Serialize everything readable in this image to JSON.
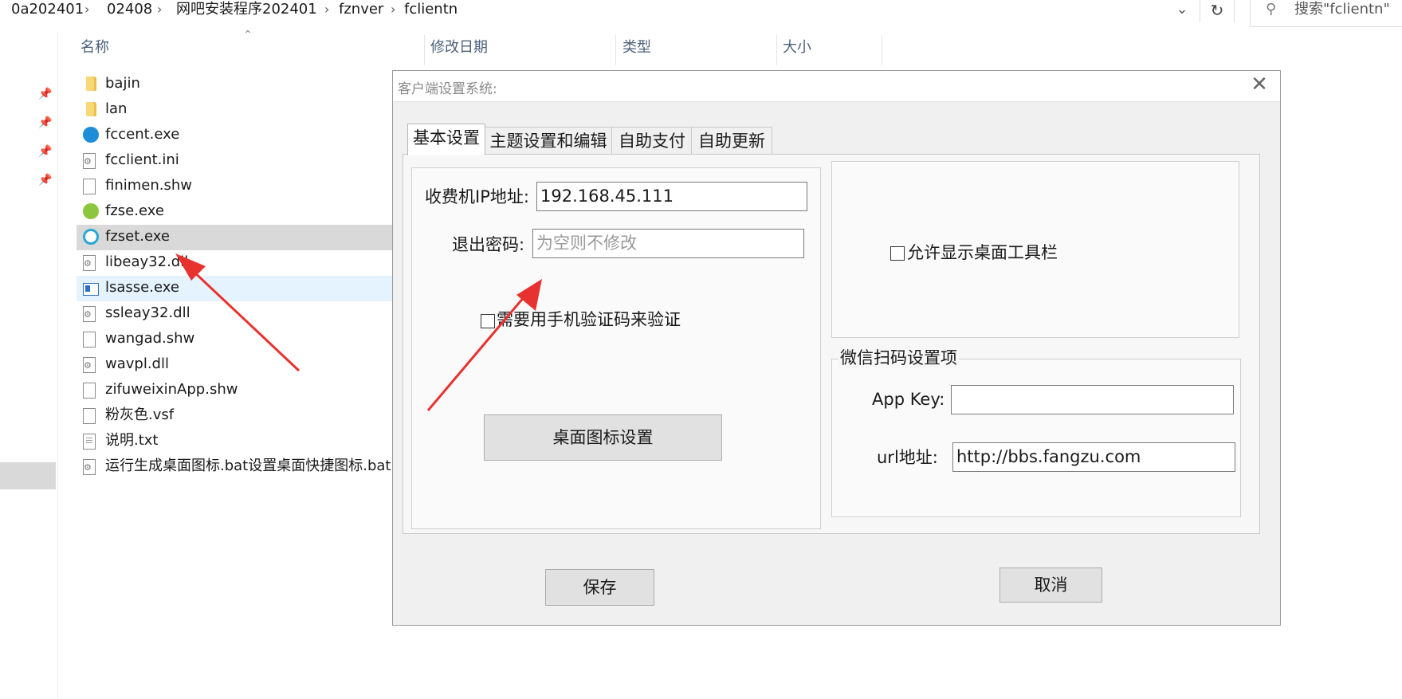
{
  "address_bar": {
    "crumbs": [
      "0a202401",
      "02408",
      "网吧安装程序202401",
      "fznver",
      "fclientn"
    ],
    "separator": "›",
    "dropdown_icon": "chevron-down-icon",
    "refresh_icon": "refresh-icon",
    "search_placeholder": "搜索\"fclientn\""
  },
  "columns": {
    "name": "名称",
    "modified": "修改日期",
    "type": "类型",
    "size": "大小"
  },
  "files": [
    {
      "name": "bajin",
      "icon": "folder-icon"
    },
    {
      "name": "lan",
      "icon": "folder-icon"
    },
    {
      "name": "fccent.exe",
      "icon": "app-icon"
    },
    {
      "name": "fcclient.ini",
      "icon": "settings-file-icon"
    },
    {
      "name": "finimen.shw",
      "icon": "file-icon"
    },
    {
      "name": "fzse.exe",
      "icon": "app-icon"
    },
    {
      "name": "fzset.exe",
      "icon": "app-icon",
      "selected": true
    },
    {
      "name": "libeay32.dll",
      "icon": "dll-icon"
    },
    {
      "name": "lsasse.exe",
      "icon": "window-app-icon",
      "hover": true
    },
    {
      "name": "ssleay32.dll",
      "icon": "dll-icon"
    },
    {
      "name": "wangad.shw",
      "icon": "file-icon"
    },
    {
      "name": "wavpl.dll",
      "icon": "dll-icon"
    },
    {
      "name": "zifuweixinApp.shw",
      "icon": "file-icon"
    },
    {
      "name": "粉灰色.vsf",
      "icon": "file-icon"
    },
    {
      "name": "说明.txt",
      "icon": "text-file-icon"
    },
    {
      "name": "运行生成桌面图标.bat设置桌面快捷图标.bat",
      "icon": "batch-file-icon"
    }
  ],
  "dialog": {
    "title": "客户端设置系统:",
    "tabs": [
      "基本设置",
      "主题设置和编辑",
      "自助支付",
      "自助更新"
    ],
    "active_tab": 0,
    "ip_label": "收费机IP地址:",
    "ip_value": "192.168.45.111",
    "exit_pwd_label": "退出密码:",
    "exit_pwd_placeholder": "为空则不修改",
    "sms_verify_label": "需要用手机验证码来验证",
    "sms_verify_checked": false,
    "desktop_icon_button": "桌面图标设置",
    "toolbar_label": "允许显示桌面工具栏",
    "toolbar_checked": false,
    "wechat_group": "微信扫码设置项",
    "appkey_label": "App Key:",
    "appkey_value": "",
    "url_label": "url地址:",
    "url_value": "http://bbs.fangzu.com",
    "save_button": "保存",
    "cancel_button": "取消"
  },
  "colors": {
    "annotation_arrow": "#e8322f",
    "selected_row": "#d9d9d9",
    "hover_row": "#e5f3ff",
    "dialog_bg": "#f0f0f0"
  }
}
